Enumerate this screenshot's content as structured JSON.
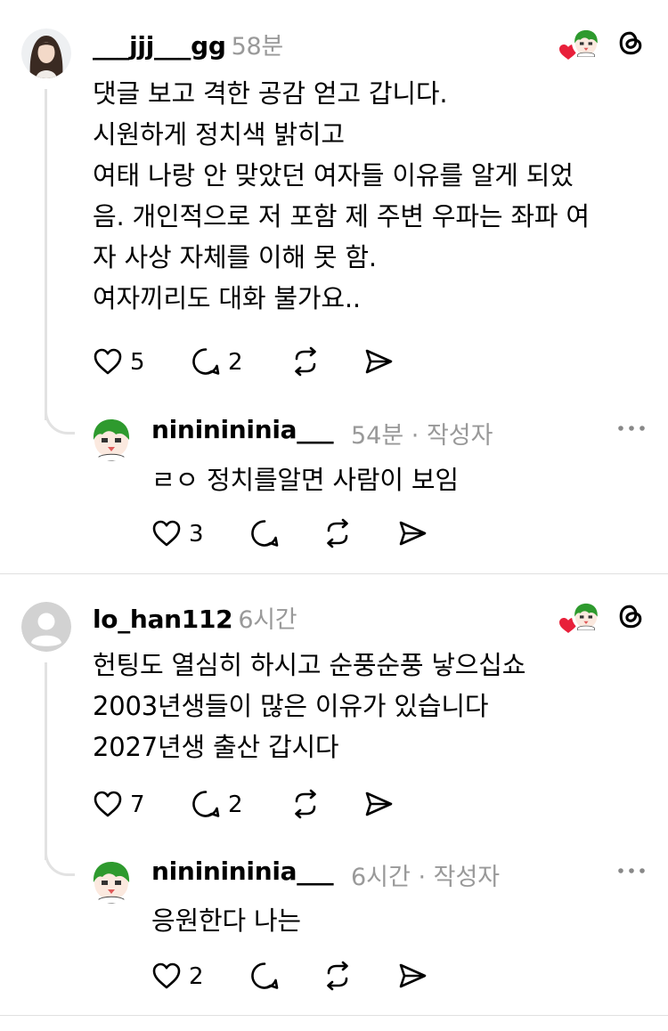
{
  "threads": [
    {
      "comment": {
        "username": "___jjj___gg",
        "time": "58분",
        "lines": [
          "댓글 보고 격한 공감 얻고 갑니다.",
          "시원하게 정치색 밝히고",
          "여태 나랑 안 맞았던 여자들 이유를 알게 되었",
          "음. 개인적으로 저 포함 제 주변 우파는 좌파 여",
          "자 사상 자체를 이해 못 함.",
          "여자끼리도 대화 불가요.."
        ],
        "likes": "5",
        "replies": "2"
      },
      "reply": {
        "username": "nininininia___",
        "time": "54분",
        "author_tag": "· 작성자",
        "text": "ㄹㅇ 정치를알면 사람이 보임",
        "likes": "3"
      }
    },
    {
      "comment": {
        "username": "lo_han112",
        "time": "6시간",
        "lines": [
          "헌팅도 열심히 하시고 순풍순풍 낳으십쇼",
          "2003년생들이 많은 이유가 있습니다",
          "2027년생 출산 갑시다"
        ],
        "likes": "7",
        "replies": "2"
      },
      "reply": {
        "username": "nininininia___",
        "time": "6시간",
        "author_tag": "· 작성자",
        "text": "응원한다 나는",
        "likes": "2"
      }
    }
  ],
  "colors": {
    "heart_badge": "#e8203a",
    "avatar_green": "#2e9a2e",
    "muted_text": "#999999"
  },
  "icons": [
    "heart-icon",
    "comment-icon",
    "repost-icon",
    "share-icon",
    "threads-logo-icon",
    "more-icon",
    "liked-by-author-badge"
  ]
}
